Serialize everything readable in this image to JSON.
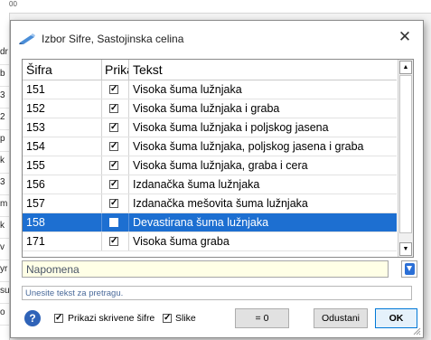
{
  "background": {
    "top_label": "00",
    "left_cells": [
      "dr",
      "b",
      "3",
      "2",
      "p",
      "k",
      "3",
      "m",
      "k",
      "v",
      "yr",
      "su",
      "o"
    ]
  },
  "dialog": {
    "title": "Izbor Sifre, Sastojinska celina",
    "close_label": "✕"
  },
  "table": {
    "columns": [
      "Šifra",
      "Prikaz",
      "Tekst"
    ],
    "rows": [
      {
        "sifra": "151",
        "prikaz": true,
        "tekst": "Visoka šuma lužnjaka",
        "selected": false
      },
      {
        "sifra": "152",
        "prikaz": true,
        "tekst": "Visoka šuma lužnjaka  i graba",
        "selected": false
      },
      {
        "sifra": "153",
        "prikaz": true,
        "tekst": "Visoka šuma lužnjaka i poljskog jasena",
        "selected": false
      },
      {
        "sifra": "154",
        "prikaz": true,
        "tekst": "Visoka šuma lužnjaka, poljskog jasena  i graba",
        "selected": false
      },
      {
        "sifra": "155",
        "prikaz": true,
        "tekst": "Visoka šuma lužnjaka, graba i cera",
        "selected": false
      },
      {
        "sifra": "156",
        "prikaz": true,
        "tekst": "Izdanačka šuma lužnjaka",
        "selected": false
      },
      {
        "sifra": "157",
        "prikaz": true,
        "tekst": "Izdanačka mešovita šuma lužnjaka",
        "selected": false
      },
      {
        "sifra": "158",
        "prikaz": false,
        "tekst": "Devastirana šuma lužnjaka",
        "selected": true
      },
      {
        "sifra": "171",
        "prikaz": true,
        "tekst": "Visoka šuma graba",
        "selected": false
      }
    ]
  },
  "napomena": {
    "label": "Napomena"
  },
  "search": {
    "placeholder": "Unesite tekst za pretragu."
  },
  "bottom": {
    "prikazi_label": "Prikazi skrivene šifre",
    "prikazi_checked": true,
    "slike_label": "Slike",
    "slike_checked": true,
    "zero_label": "= 0",
    "cancel_label": "Odustani",
    "ok_label": "OK"
  },
  "colors": {
    "selection": "#1d6fd1",
    "napomena_bg": "#ffffe6",
    "ok_border": "#0078d7"
  }
}
